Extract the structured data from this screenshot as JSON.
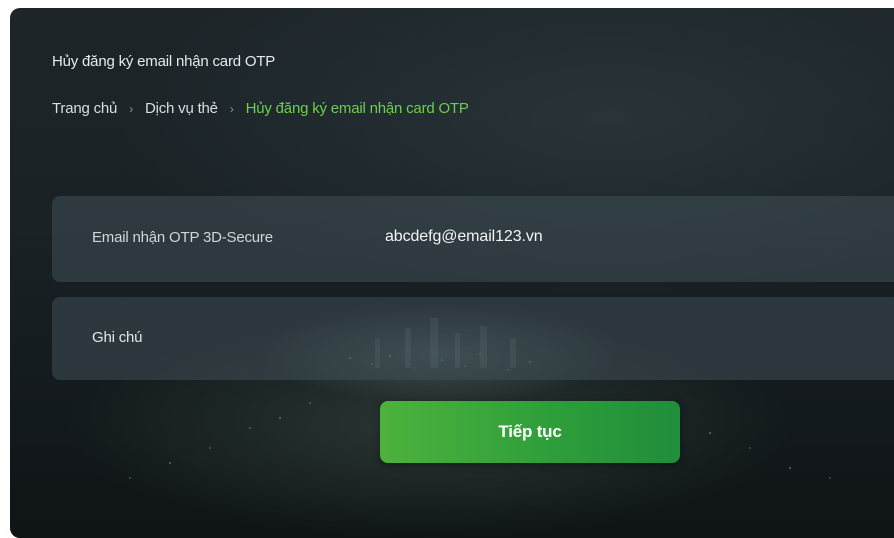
{
  "page": {
    "title": "Hủy đăng ký email nhận card OTP"
  },
  "breadcrumb": {
    "items": [
      {
        "label": "Trang chủ"
      },
      {
        "label": "Dịch vụ thẻ"
      },
      {
        "label": "Hủy đăng ký email nhận card OTP"
      }
    ],
    "separator": "›"
  },
  "form": {
    "email": {
      "label": "Email nhận OTP 3D-Secure",
      "value": "abcdefg@email123.vn"
    },
    "note": {
      "label": "Ghi chú"
    }
  },
  "actions": {
    "continue_label": "Tiếp tục"
  },
  "colors": {
    "accent_green": "#6ad04a",
    "button_green_start": "#4db23c",
    "button_green_end": "#208d3a",
    "background_dark": "#1a2226"
  }
}
